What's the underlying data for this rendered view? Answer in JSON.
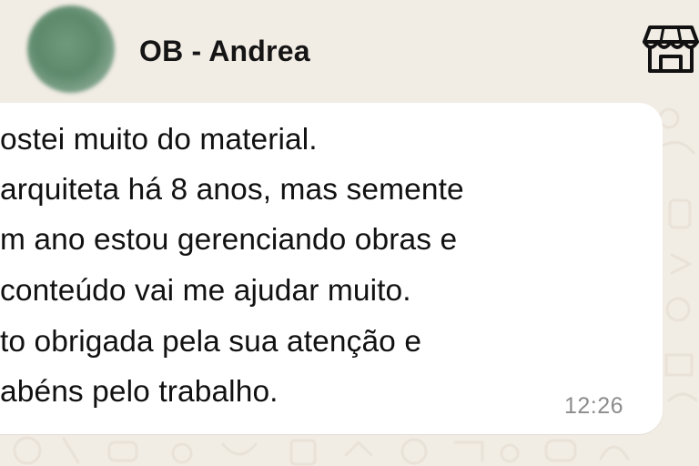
{
  "header": {
    "contact_name": "OB - Andrea",
    "avatar_icon": "avatar-blurred",
    "action_icon": "store-icon"
  },
  "message": {
    "lines": [
      "ostei muito do material.",
      "arquiteta há 8 anos, mas semente",
      "m ano estou gerenciando obras e",
      "conteúdo vai me ajudar muito.",
      "to obrigada pela sua atenção e",
      "abéns pelo trabalho."
    ],
    "time": "12:26"
  },
  "colors": {
    "background": "#f1ece4",
    "bubble": "#ffffff",
    "text": "#111111",
    "timestamp": "#8c8c8c",
    "avatar": "#6f9a7c"
  }
}
